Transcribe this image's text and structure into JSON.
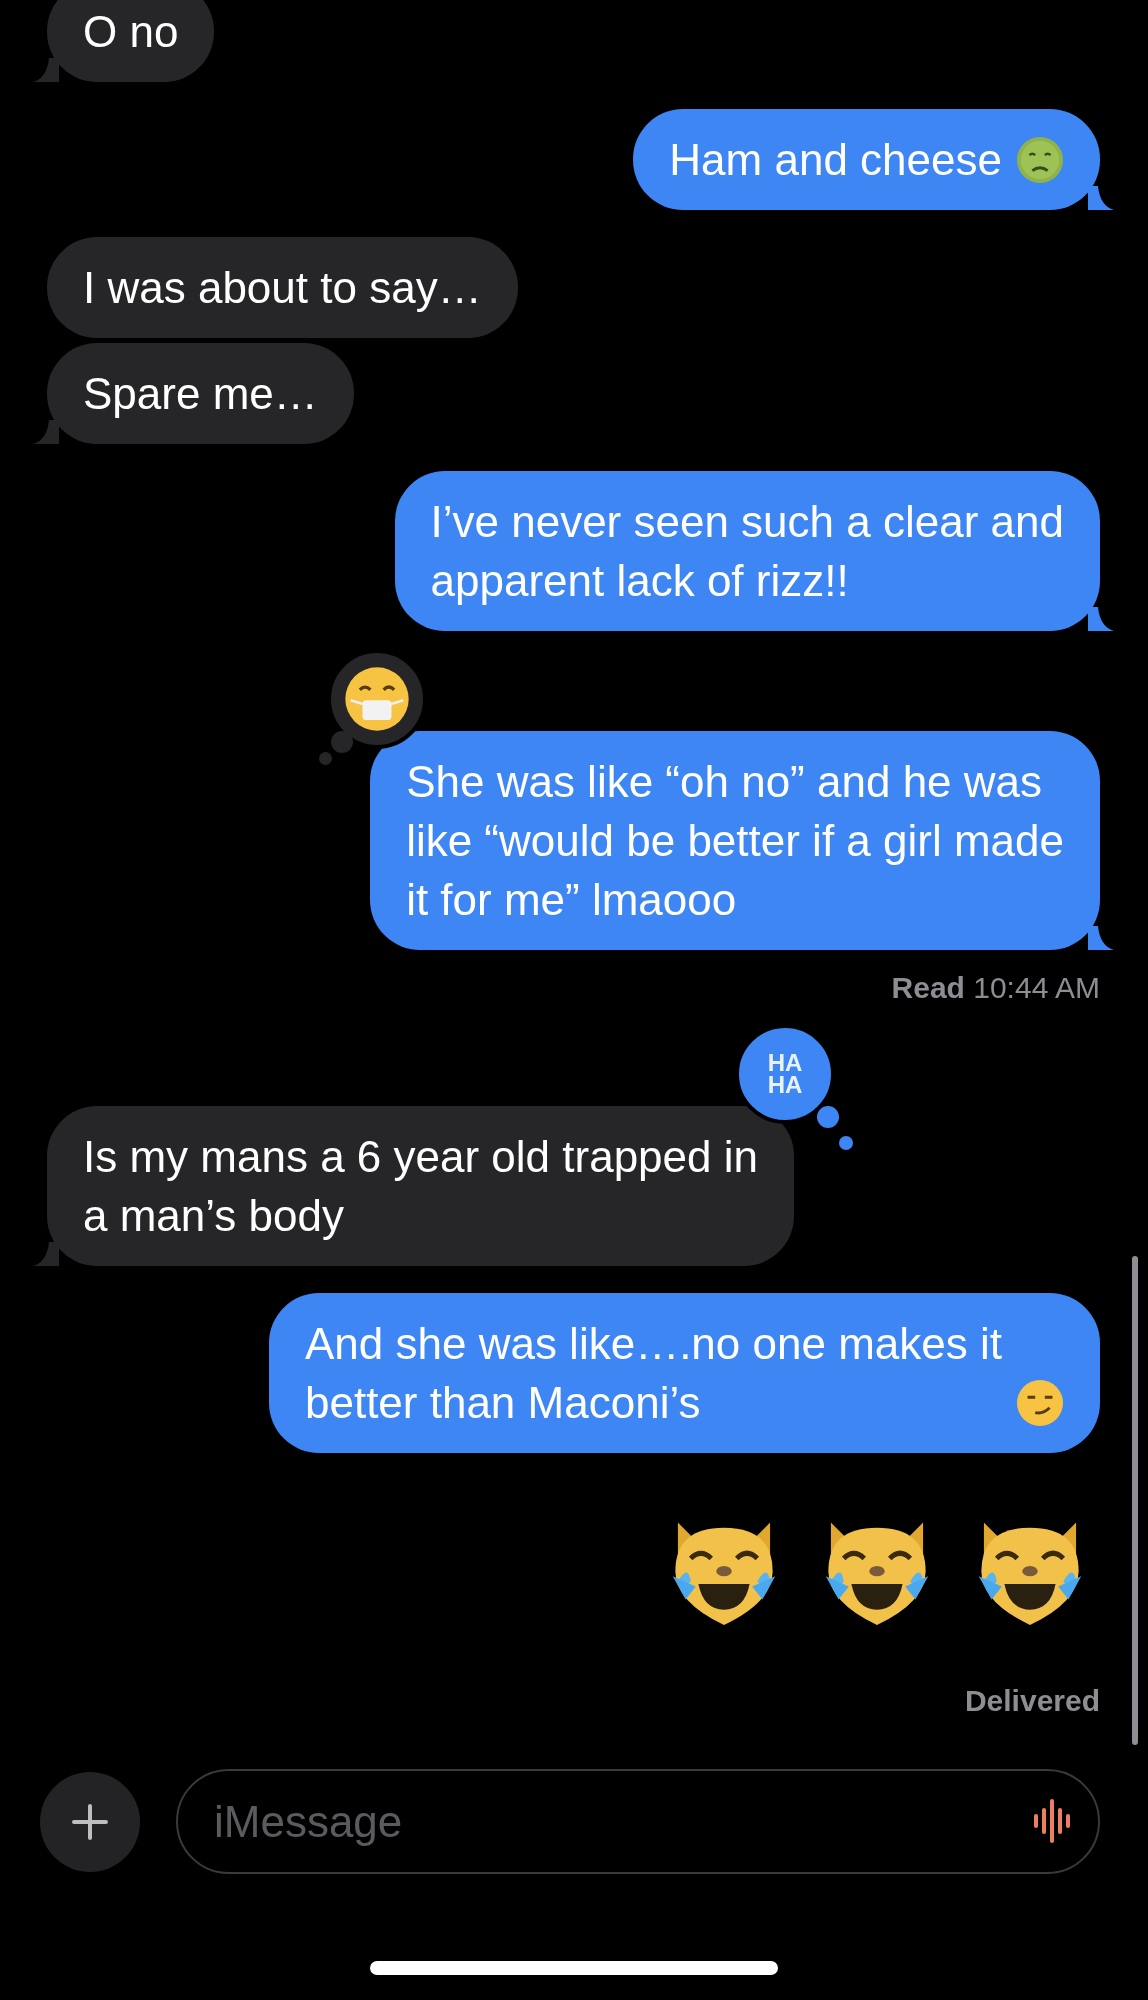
{
  "messages": [
    {
      "kind": "bubble",
      "outgoing": false,
      "text": "O no",
      "tail": true
    },
    {
      "kind": "bubble",
      "outgoing": true,
      "text": "Ham and cheese",
      "emoji": {
        "kind": "nauseated"
      },
      "tail": true
    },
    {
      "kind": "bubble",
      "outgoing": false,
      "text": "I was about to say…",
      "tail": false
    },
    {
      "kind": "bubble",
      "outgoing": false,
      "text": "Spare me…",
      "tail": true
    },
    {
      "kind": "bubble",
      "outgoing": true,
      "text": "I’ve never seen such a clear and\napparent lack of rizz!!",
      "tail": true
    },
    {
      "kind": "bubble",
      "outgoing": true,
      "text": "She was like “oh no” and he was\nlike “would be better if a girl made\nit for me” lmaooo",
      "tail": true,
      "reaction": {
        "kind": "mask"
      }
    },
    {
      "kind": "receipt",
      "text": "**Read** 10:44 AM"
    },
    {
      "kind": "bubble",
      "outgoing": false,
      "text": "Is my mans a 6 year old trapped in\na man’s body",
      "tail": true,
      "reaction": {
        "kind": "label",
        "text": "HA\nHA"
      }
    },
    {
      "kind": "bubble",
      "outgoing": true,
      "text": "And she was like….no one makes it\nbetter than Maconi’s",
      "emoji": {
        "kind": "smirk"
      },
      "tail": false
    },
    {
      "kind": "emoji_row",
      "outgoing": true,
      "emojis": [
        {
          "kind": "cat_joy"
        },
        {
          "kind": "cat_joy"
        },
        {
          "kind": "cat_joy"
        }
      ]
    },
    {
      "kind": "receipt",
      "text": "**Delivered**"
    }
  ],
  "composer": {
    "placeholder": "iMessage"
  }
}
